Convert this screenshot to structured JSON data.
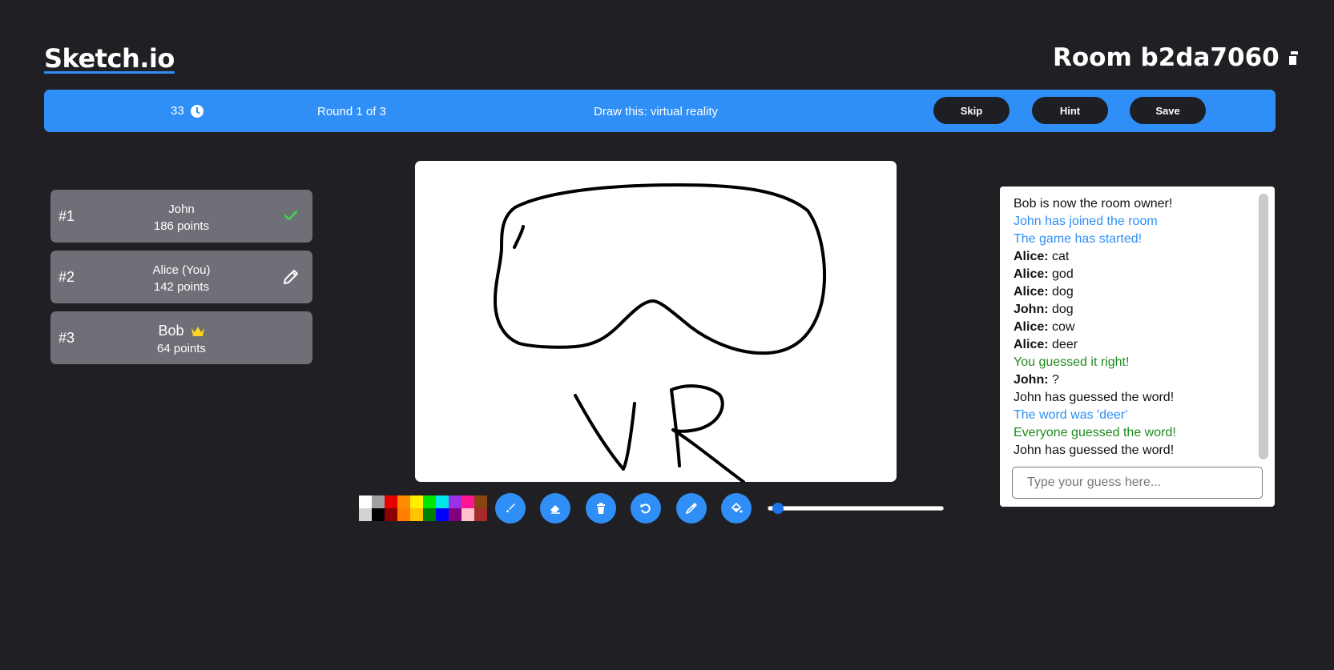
{
  "app": {
    "logo": "Sketch.io",
    "room_label": "Room b2da7060"
  },
  "topbar": {
    "timer": "33",
    "round": "Round 1 of 3",
    "word_prompt": "Draw this: virtual reality",
    "skip_label": "Skip",
    "hint_label": "Hint",
    "save_label": "Save"
  },
  "players": [
    {
      "rank": "#1",
      "name": "John",
      "points": "186 points",
      "status_icon": "check-icon"
    },
    {
      "rank": "#2",
      "name": "Alice (You)",
      "points": "142 points",
      "status_icon": "pencil-icon"
    },
    {
      "rank": "#3",
      "name": "Bob",
      "points": "64 points",
      "status_icon": "crown-icon"
    }
  ],
  "palette": [
    "#ffffff",
    "#a0a0a0",
    "#e60000",
    "#ff8c00",
    "#ffee00",
    "#00e600",
    "#00e6e6",
    "#9b30e6",
    "#ff1493",
    "#8b4513",
    "#d3d3d3",
    "#000000",
    "#8b0000",
    "#ff7f00",
    "#ffc300",
    "#008000",
    "#0000ff",
    "#800080",
    "#ffc0cb",
    "#a52a2a"
  ],
  "tools": [
    "brush-icon",
    "eraser-icon",
    "trash-icon",
    "undo-icon",
    "eyedropper-icon",
    "fill-bucket-icon"
  ],
  "brush_size_fraction": 0.03,
  "chat": {
    "messages": [
      {
        "author": "",
        "text": "Bob is now the room owner!",
        "style": "plain"
      },
      {
        "author": "",
        "text": "John has joined the room",
        "style": "sys-blue"
      },
      {
        "author": "",
        "text": "The game has started!",
        "style": "sys-blue"
      },
      {
        "author": "Alice:",
        "text": " cat",
        "style": "plain"
      },
      {
        "author": "Alice:",
        "text": " god",
        "style": "plain"
      },
      {
        "author": "Alice:",
        "text": " dog",
        "style": "plain"
      },
      {
        "author": "John:",
        "text": " dog",
        "style": "plain"
      },
      {
        "author": "Alice:",
        "text": " cow",
        "style": "plain"
      },
      {
        "author": "Alice:",
        "text": " deer",
        "style": "plain"
      },
      {
        "author": "",
        "text": "You guessed it right!",
        "style": "sys-green"
      },
      {
        "author": "John:",
        "text": " ?",
        "style": "plain"
      },
      {
        "author": "",
        "text": "John has guessed the word!",
        "style": "plain"
      },
      {
        "author": "",
        "text": "The word was 'deer'",
        "style": "sys-blue"
      },
      {
        "author": "",
        "text": "Everyone guessed the word!",
        "style": "sys-green"
      },
      {
        "author": "",
        "text": "John has guessed the word!",
        "style": "plain"
      }
    ],
    "input_placeholder": "Type your guess here..."
  },
  "colors": {
    "accent": "#2f8ff7",
    "background": "#202024",
    "player_card": "#6f7077",
    "check": "#3ddc4a",
    "crown": "#ffd21f"
  }
}
